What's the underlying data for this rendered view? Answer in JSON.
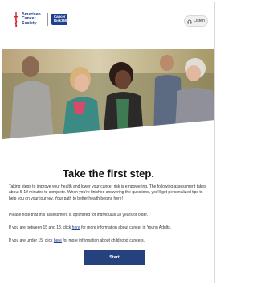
{
  "header": {
    "logo_org_line1": "American",
    "logo_org_line2": "Cancer",
    "logo_org_line3": "Society",
    "logo_badge_line1": "Cancer",
    "logo_badge_line2": "Risk360",
    "listen_label": "Listen"
  },
  "main": {
    "title": "Take the first step.",
    "intro": "Taking steps to improve your health and lower your cancer risk is empowering. The following assessment takes about 5-10 minutes to complete. When you're finished answering the questions, you'll get personalized tips to help you on your journey. Your path to better health begins here!",
    "age_note": "Please note that this assessment is optimized for individuals 18 years or older.",
    "young_adult_prefix": "If you are between 15 and 18, click ",
    "young_adult_link": "here",
    "young_adult_suffix": " for more information about cancer in Young Adults.",
    "child_prefix": "If you are under 15, click ",
    "child_link": "here",
    "child_suffix": " for more information about childhood cancers.",
    "start_label": "Start"
  },
  "colors": {
    "brand_blue": "#25427f",
    "brand_red": "#d6202b",
    "link": "#1d3f8e"
  }
}
